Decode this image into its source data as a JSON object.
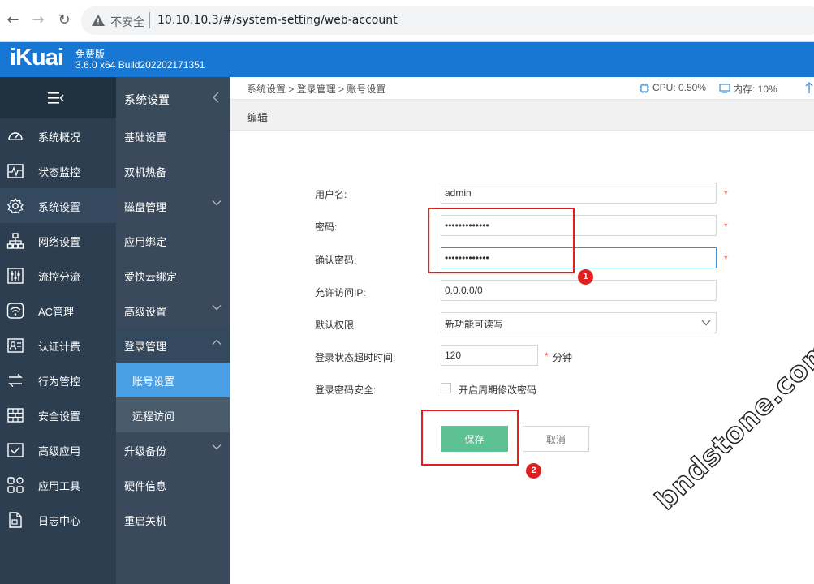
{
  "browser": {
    "insecure_label": "不安全",
    "url": "10.10.10.3/#/system-setting/web-account"
  },
  "header": {
    "logo": "iKuai",
    "edition": "免费版",
    "version": "3.6.0 x64 Build202202171351"
  },
  "sidebar": {
    "items": [
      {
        "label": "系统概况",
        "icon": "dashboard-icon"
      },
      {
        "label": "状态监控",
        "icon": "monitor-icon"
      },
      {
        "label": "系统设置",
        "icon": "gear-icon",
        "active": true
      },
      {
        "label": "网络设置",
        "icon": "network-icon"
      },
      {
        "label": "流控分流",
        "icon": "sliders-icon"
      },
      {
        "label": "AC管理",
        "icon": "wifi-icon"
      },
      {
        "label": "认证计费",
        "icon": "id-card-icon"
      },
      {
        "label": "行为管控",
        "icon": "exchange-icon"
      },
      {
        "label": "安全设置",
        "icon": "firewall-icon"
      },
      {
        "label": "高级应用",
        "icon": "checklist-icon"
      },
      {
        "label": "应用工具",
        "icon": "apps-icon"
      },
      {
        "label": "日志中心",
        "icon": "document-icon"
      }
    ]
  },
  "subnav": {
    "title": "系统设置",
    "items": [
      {
        "label": "基础设置"
      },
      {
        "label": "双机热备"
      },
      {
        "label": "磁盘管理",
        "expandable": true
      },
      {
        "label": "应用绑定"
      },
      {
        "label": "爱快云绑定"
      },
      {
        "label": "高级设置",
        "expandable": true
      },
      {
        "label": "登录管理",
        "expandable": true,
        "open": true
      },
      {
        "label": "账号设置",
        "child": true,
        "active": true
      },
      {
        "label": "远程访问",
        "child": true
      },
      {
        "label": "升级备份",
        "expandable": true
      },
      {
        "label": "硬件信息"
      },
      {
        "label": "重启关机"
      }
    ]
  },
  "topbar": {
    "breadcrumb": "系统设置 > 登录管理 > 账号设置",
    "cpu": "CPU: 0.50%",
    "mem": "内存: 10%"
  },
  "panel": {
    "title": "编辑"
  },
  "form": {
    "username_label": "用户名:",
    "username_value": "admin",
    "password_label": "密码:",
    "password_value": "•••••••••••••",
    "confirm_label": "确认密码:",
    "confirm_value": "•••••••••••••",
    "allow_ip_label": "允许访问IP:",
    "allow_ip_value": "0.0.0.0/0",
    "permission_label": "默认权限:",
    "permission_value": "新功能可读写",
    "timeout_label": "登录状态超时时间:",
    "timeout_value": "120",
    "timeout_unit": "分钟",
    "security_label": "登录密码安全:",
    "security_checkbox_label": "开启周期修改密码",
    "required_mark": "*",
    "save_label": "保存",
    "cancel_label": "取消"
  },
  "annotations": {
    "badge1": "1",
    "badge2": "2",
    "color": "#e02020"
  },
  "watermark": "bndstone.com",
  "colors": {
    "header_blue": "#1877d2",
    "sidebar": "#2c3e50",
    "active_blue": "#4a9ee3",
    "save_green": "#5ec194"
  }
}
